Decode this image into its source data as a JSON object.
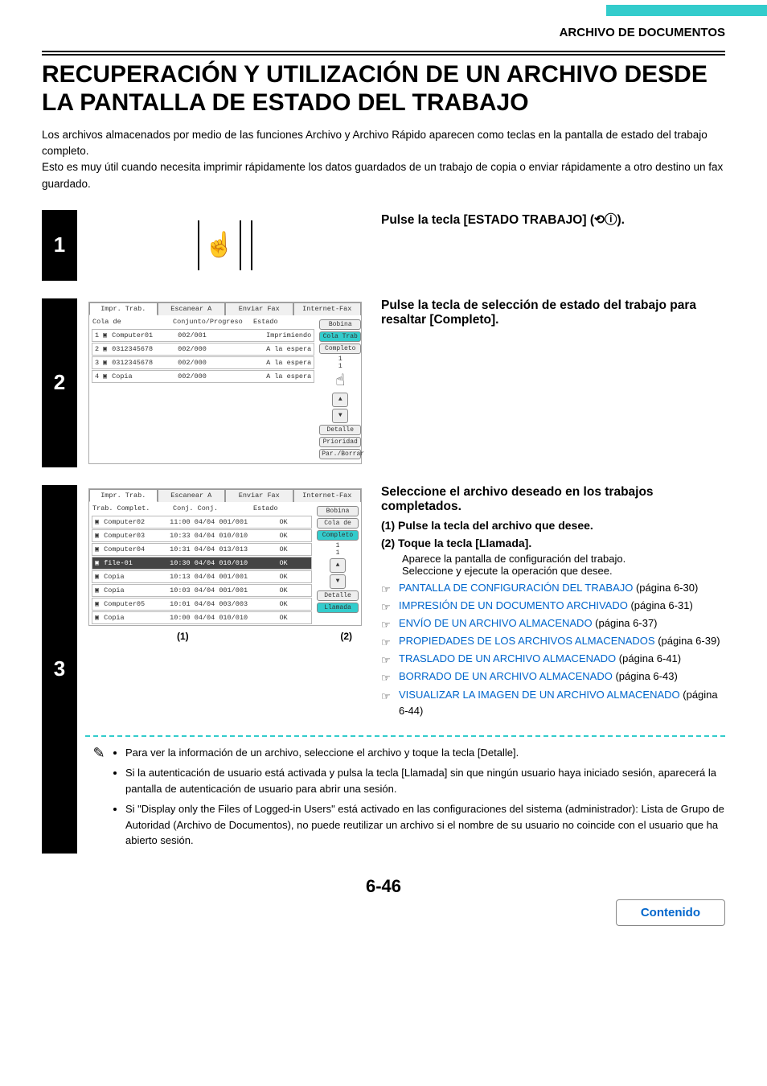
{
  "header": {
    "section": "ARCHIVO DE DOCUMENTOS"
  },
  "title": "RECUPERACIÓN Y UTILIZACIÓN DE UN ARCHIVO DESDE LA PANTALLA DE ESTADO DEL TRABAJO",
  "intro1": "Los archivos almacenados por medio de las funciones Archivo y Archivo Rápido aparecen como teclas en la pantalla de estado del trabajo completo.",
  "intro2": "Esto es muy útil cuando necesita imprimir rápidamente los datos guardados de un trabajo de copia o enviar rápidamente a otro destino un fax guardado.",
  "step1": {
    "num": "1",
    "text_a": "Pulse la tecla [ESTADO TRABAJO] (",
    "text_b": ")."
  },
  "step2": {
    "num": "2",
    "text": "Pulse la tecla de selección de estado del trabajo para resaltar [Completo].",
    "ui": {
      "tabs": [
        "Impr. Trab.",
        "Escanear A",
        "Enviar Fax",
        "Internet-Fax"
      ],
      "cols": [
        "Cola de",
        "Conjunto/Progreso",
        "Estado"
      ],
      "rows": [
        {
          "n": "1",
          "name": "Computer01",
          "sets": "002/001",
          "stat": "Imprimiendo"
        },
        {
          "n": "2",
          "name": "0312345678",
          "sets": "002/000",
          "stat": "A la espera"
        },
        {
          "n": "3",
          "name": "0312345678",
          "sets": "002/000",
          "stat": "A la espera"
        },
        {
          "n": "4",
          "name": "Copia",
          "sets": "002/000",
          "stat": "A la espera"
        }
      ],
      "side": [
        "Bobina",
        "Cola Trab",
        "Completo",
        "Detalle",
        "Prioridad",
        "Par./Borrar"
      ]
    }
  },
  "step3": {
    "num": "3",
    "title": "Seleccione el archivo deseado en los trabajos completados.",
    "s1": "(1)  Pulse la tecla del archivo que desee.",
    "s2": "(2)  Toque la tecla [Llamada].",
    "p1": "Aparece la pantalla de configuración del trabajo.",
    "p2": "Seleccione y ejecute la operación que desee.",
    "links": [
      {
        "t": "PANTALLA DE CONFIGURACIÓN DEL TRABAJO",
        "pg": "(página 6-30)"
      },
      {
        "t": "IMPRESIÓN DE UN DOCUMENTO ARCHIVADO",
        "pg": "(página 6-31)"
      },
      {
        "t": "ENVÍO DE UN ARCHIVO ALMACENADO",
        "pg": "(página 6-37)"
      },
      {
        "t": " PROPIEDADES DE LOS ARCHIVOS ALMACENADOS",
        "pg": " (página 6-39)"
      },
      {
        "t": "TRASLADO DE UN ARCHIVO ALMACENADO",
        "pg": "(página 6-41)"
      },
      {
        "t": "BORRADO DE UN ARCHIVO ALMACENADO",
        "pg": "(página 6-43)"
      },
      {
        "t": "VISUALIZAR LA IMAGEN DE UN ARCHIVO ALMACENADO",
        "pg": " (página 6-44)"
      }
    ],
    "callouts": [
      "(1)",
      "(2)"
    ],
    "ui": {
      "tabs": [
        "Impr. Trab.",
        "Escanear A",
        "Enviar Fax",
        "Internet-Fax"
      ],
      "cols": [
        "Trab. Complet.",
        "Conj.   Conj.",
        "Estado"
      ],
      "rows": [
        {
          "name": "Computer02",
          "sets": "11:00 04/04 001/001",
          "stat": "OK",
          "hl": false
        },
        {
          "name": "Computer03",
          "sets": "10:33 04/04 010/010",
          "stat": "OK",
          "hl": false
        },
        {
          "name": "Computer04",
          "sets": "10:31 04/04 013/013",
          "stat": "OK",
          "hl": false
        },
        {
          "name": "file-01",
          "sets": "10:30 04/04 010/010",
          "stat": "OK",
          "hl": true
        },
        {
          "name": "Copia",
          "sets": "10:13 04/04 001/001",
          "stat": "OK",
          "hl": false
        },
        {
          "name": "Copia",
          "sets": "10:03 04/04 001/001",
          "stat": "OK",
          "hl": false
        },
        {
          "name": "Computer05",
          "sets": "10:01 04/04 003/003",
          "stat": "OK",
          "hl": false
        },
        {
          "name": "Copia",
          "sets": "10:00 04/04 010/010",
          "stat": "OK",
          "hl": false
        }
      ],
      "side": [
        "Bobina",
        "Cola de",
        "Completo",
        "Detalle",
        "Llamada"
      ]
    }
  },
  "notes": [
    "Para ver la información de un archivo, seleccione el archivo y toque la tecla [Detalle].",
    "Si la autenticación de usuario está activada y pulsa la tecla [Llamada] sin que ningún usuario haya iniciado sesión, aparecerá la pantalla de autenticación de usuario para abrir una sesión.",
    "Si \"Display only the Files of Logged-in Users\" está activado en las configuraciones del sistema (administrador): Lista de Grupo de Autoridad (Archivo de Documentos), no puede reutilizar un archivo si el nombre de su usuario no coincide con el usuario que ha abierto sesión."
  ],
  "pagenum": "6-46",
  "contenido": "Contenido"
}
